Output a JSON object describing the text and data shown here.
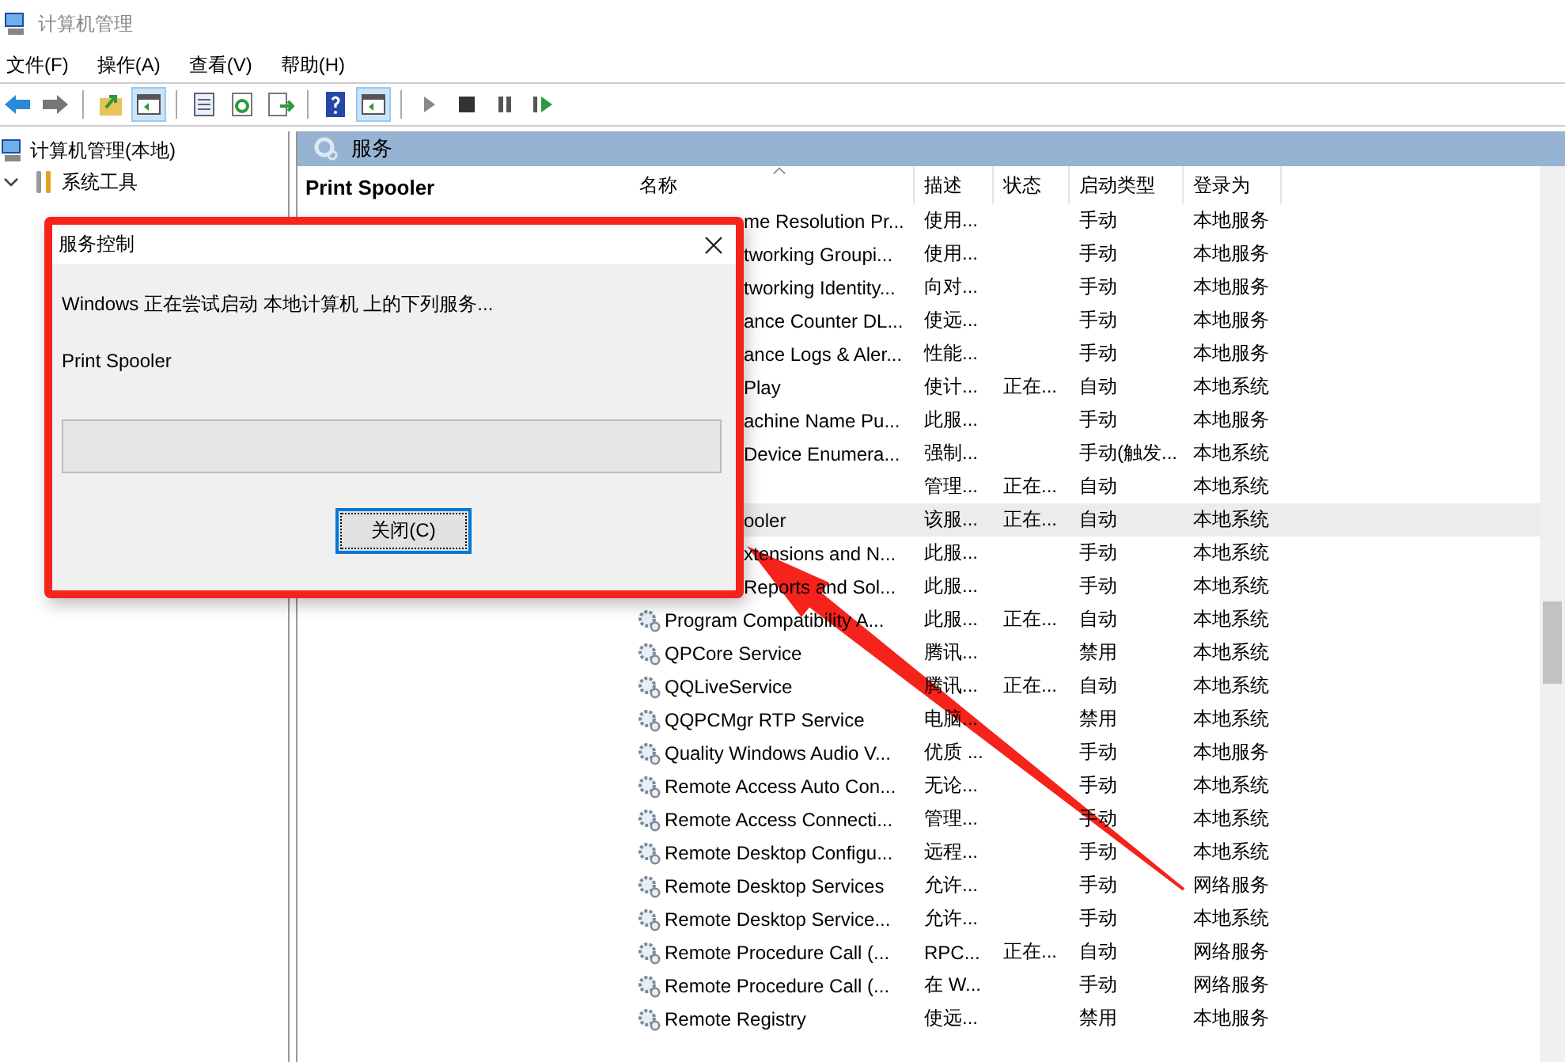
{
  "window": {
    "title": "计算机管理"
  },
  "menu": [
    "文件(F)",
    "操作(A)",
    "查看(V)",
    "帮助(H)"
  ],
  "toolbar": [
    {
      "kind": "back",
      "pressed": false
    },
    {
      "kind": "forward",
      "pressed": false
    },
    {
      "kind": "sep"
    },
    {
      "kind": "up",
      "pressed": false
    },
    {
      "kind": "tree",
      "pressed": true
    },
    {
      "kind": "sep"
    },
    {
      "kind": "props",
      "pressed": false
    },
    {
      "kind": "refresh",
      "pressed": false
    },
    {
      "kind": "export",
      "pressed": false
    },
    {
      "kind": "sep"
    },
    {
      "kind": "help",
      "pressed": false
    },
    {
      "kind": "pane",
      "pressed": true
    },
    {
      "kind": "sep"
    },
    {
      "kind": "play",
      "pressed": false
    },
    {
      "kind": "stop",
      "pressed": false
    },
    {
      "kind": "pause",
      "pressed": false
    },
    {
      "kind": "resume",
      "pressed": false
    }
  ],
  "tree": {
    "label": "计算机管理(本地)",
    "children": [
      {
        "label": "系统工具",
        "expanded": true
      }
    ]
  },
  "pane_header": "服务",
  "detail_title": "Print Spooler",
  "columns": [
    {
      "label": "名称",
      "sorted": true
    },
    {
      "label": "描述",
      "sorted": false
    },
    {
      "label": "状态",
      "sorted": false
    },
    {
      "label": "启动类型",
      "sorted": false
    },
    {
      "label": "登录为",
      "sorted": false
    }
  ],
  "rows": [
    {
      "name": "me Resolution Pr...",
      "covered": true,
      "desc": "使用...",
      "start": "手动",
      "logon": "本地服务",
      "selected": false
    },
    {
      "name": "tworking Groupi...",
      "covered": true,
      "desc": "使用...",
      "start": "手动",
      "logon": "本地服务",
      "selected": false
    },
    {
      "name": "tworking Identity...",
      "covered": true,
      "desc": "向对...",
      "start": "手动",
      "logon": "本地服务",
      "selected": false
    },
    {
      "name": "ance Counter DL...",
      "covered": true,
      "desc": "使远...",
      "start": "手动",
      "logon": "本地服务",
      "selected": false
    },
    {
      "name": "ance Logs & Aler...",
      "covered": true,
      "desc": "性能...",
      "start": "手动",
      "logon": "本地服务",
      "selected": false
    },
    {
      "name": "Play",
      "covered": true,
      "desc": "使计...",
      "status": "正在...",
      "start": "自动",
      "logon": "本地系统",
      "selected": false
    },
    {
      "name": "achine Name Pu...",
      "covered": true,
      "desc": "此服...",
      "start": "手动",
      "logon": "本地服务",
      "selected": false
    },
    {
      "name": "Device Enumera...",
      "covered": true,
      "desc": "强制...",
      "start": "手动(触发...",
      "logon": "本地系统",
      "selected": false
    },
    {
      "desc": "管理...",
      "status": "正在...",
      "start": "自动",
      "logon": "本地系统",
      "selected": false
    },
    {
      "name": "ooler",
      "covered": true,
      "desc": "该服...",
      "status": "正在...",
      "start": "自动",
      "logon": "本地系统",
      "selected": true
    },
    {
      "name": "xtensions and N...",
      "covered": true,
      "desc": "此服...",
      "start": "手动",
      "logon": "本地系统",
      "selected": false
    },
    {
      "name": "Reports and Sol...",
      "covered": true,
      "desc": "此服...",
      "start": "手动",
      "logon": "本地系统",
      "selected": false
    },
    {
      "name": "Program Compatibility A...",
      "covered": false,
      "desc": "此服...",
      "status": "正在...",
      "start": "自动",
      "logon": "本地系统",
      "selected": false
    },
    {
      "name": "QPCore Service",
      "covered": false,
      "desc": "腾讯...",
      "start": "禁用",
      "logon": "本地系统",
      "selected": false
    },
    {
      "name": "QQLiveService",
      "covered": false,
      "desc": "腾讯...",
      "status": "正在...",
      "start": "自动",
      "logon": "本地系统",
      "selected": false
    },
    {
      "name": "QQPCMgr RTP Service",
      "covered": false,
      "desc": "电脑...",
      "start": "禁用",
      "logon": "本地系统",
      "selected": false
    },
    {
      "name": "Quality Windows Audio V...",
      "covered": false,
      "desc": "优质 ...",
      "start": "手动",
      "logon": "本地服务",
      "selected": false
    },
    {
      "name": "Remote Access Auto Con...",
      "covered": false,
      "desc": "无论...",
      "start": "手动",
      "logon": "本地系统",
      "selected": false
    },
    {
      "name": "Remote Access Connecti...",
      "covered": false,
      "desc": "管理...",
      "start": "手动",
      "logon": "本地系统",
      "selected": false
    },
    {
      "name": "Remote Desktop Configu...",
      "covered": false,
      "desc": "远程...",
      "start": "手动",
      "logon": "本地系统",
      "selected": false
    },
    {
      "name": "Remote Desktop Services",
      "covered": false,
      "desc": "允许...",
      "start": "手动",
      "logon": "网络服务",
      "selected": false
    },
    {
      "name": "Remote Desktop Service...",
      "covered": false,
      "desc": "允许...",
      "start": "手动",
      "logon": "本地系统",
      "selected": false
    },
    {
      "name": "Remote Procedure Call (...",
      "covered": false,
      "desc": "RPC...",
      "status": "正在...",
      "start": "自动",
      "logon": "网络服务",
      "selected": false
    },
    {
      "name": "Remote Procedure Call (...",
      "covered": false,
      "desc": "在 W...",
      "start": "手动",
      "logon": "网络服务",
      "selected": false
    },
    {
      "name": "Remote Registry",
      "covered": false,
      "desc": "使远...",
      "start": "禁用",
      "logon": "本地服务",
      "selected": false
    }
  ],
  "dialog": {
    "title": "服务控制",
    "message": "Windows 正在尝试启动 本地计算机 上的下列服务...",
    "service": "Print Spooler",
    "level": 0,
    "button": "关闭(C)"
  }
}
